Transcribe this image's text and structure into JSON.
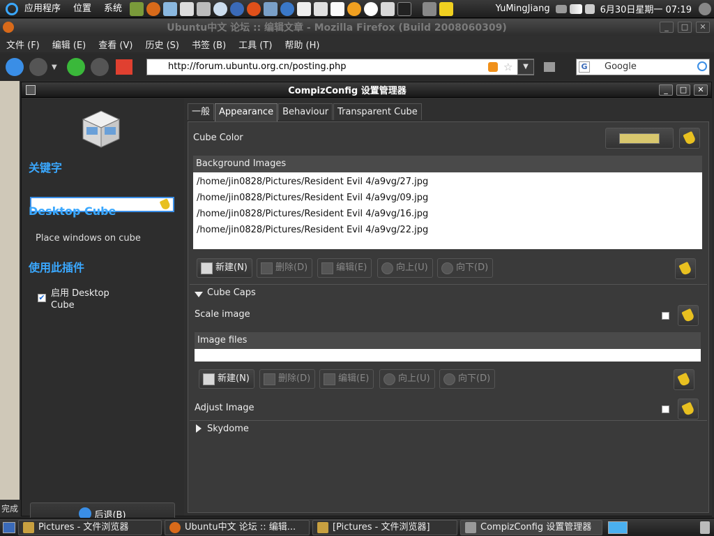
{
  "top_panel": {
    "menus": [
      "应用程序",
      "位置",
      "系统"
    ],
    "user": "YuMingJiang",
    "datetime": "6月30日星期一  07:19"
  },
  "firefox": {
    "title": "Ubuntu中文 论坛 :: 编辑文章 - Mozilla Firefox (Build 2008060309)",
    "menus": [
      "文件 (F)",
      "编辑 (E)",
      "查看 (V)",
      "历史 (S)",
      "书签 (B)",
      "工具 (T)",
      "帮助 (H)"
    ],
    "url": "http://forum.ubuntu.org.cn/posting.php",
    "search_placeholder": "Google",
    "status": "完成"
  },
  "ccsm": {
    "title": "CompizConfig 设置管理器",
    "left": {
      "keyword_heading": "关键字",
      "keyword_value": "",
      "plugin_name": "Desktop Cube",
      "plugin_desc": "Place windows on cube",
      "use_heading": "使用此插件",
      "enable_label": "启用 Desktop Cube",
      "enable_checked": true,
      "back_label": "后退(B)"
    },
    "tabs": [
      "一般",
      "Appearance",
      "Behaviour",
      "Transparent Cube"
    ],
    "active_tab": 1,
    "cube_color_label": "Cube Color",
    "cube_color": "#d8c76e",
    "bg_images_header": "Background Images",
    "bg_images": [
      "/home/jin0828/Pictures/Resident Evil 4/a9vg/27.jpg",
      "/home/jin0828/Pictures/Resident Evil 4/a9vg/09.jpg",
      "/home/jin0828/Pictures/Resident Evil 4/a9vg/16.jpg",
      "/home/jin0828/Pictures/Resident Evil 4/a9vg/22.jpg"
    ],
    "buttons": {
      "new": "新建(N)",
      "delete": "删除(D)",
      "edit": "编辑(E)",
      "up": "向上(U)",
      "down": "向下(D)"
    },
    "cube_caps_label": "Cube Caps",
    "scale_image_label": "Scale image",
    "image_files_header": "Image files",
    "adjust_image_label": "Adjust Image",
    "skydome_label": "Skydome"
  },
  "taskbar": {
    "tasks": [
      "Pictures - 文件浏览器",
      "Ubuntu中文 论坛 :: 编辑...",
      "[Pictures - 文件浏览器]",
      "CompizConfig 设置管理器"
    ]
  }
}
